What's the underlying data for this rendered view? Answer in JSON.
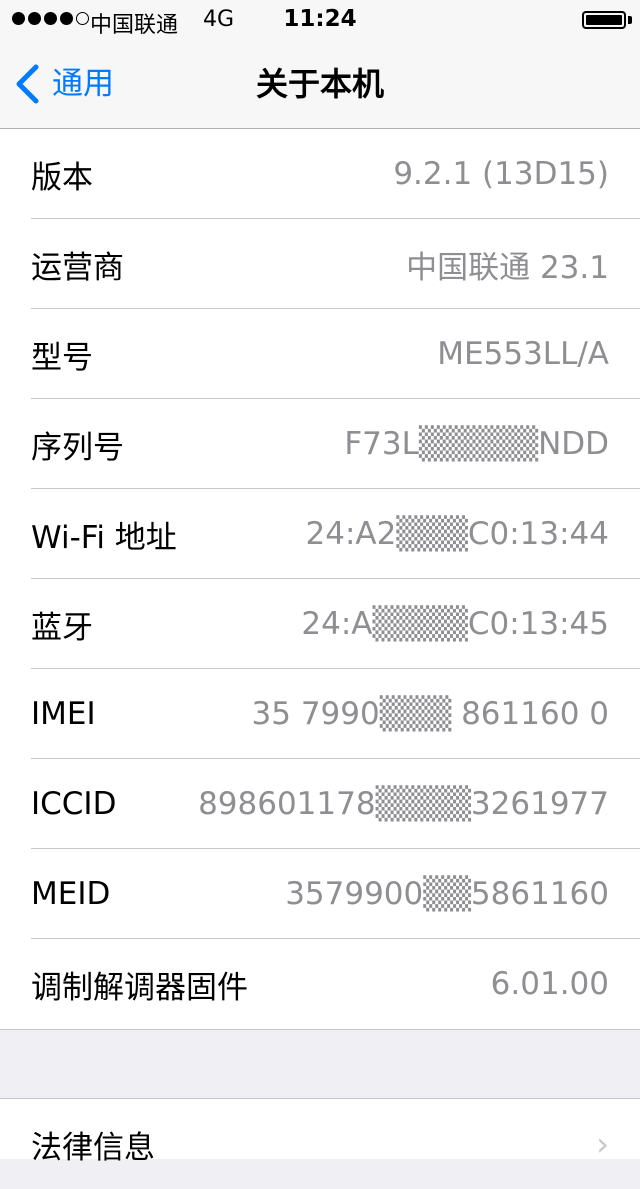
{
  "status_bar": {
    "carrier": "中国联通",
    "network": "4G",
    "time": "11:24"
  },
  "nav": {
    "back_label": "通用",
    "title": "关于本机"
  },
  "rows": [
    {
      "label": "版本",
      "value": "9.2.1 (13D15)"
    },
    {
      "label": "运营商",
      "value": "中国联通 23.1"
    },
    {
      "label": "型号",
      "value": "ME553LL/A"
    },
    {
      "label": "序列号",
      "value": "F73L▒▒▒▒▒NDD"
    },
    {
      "label": "Wi-Fi 地址",
      "value": "24:A2▒▒▒C0:13:44"
    },
    {
      "label": "蓝牙",
      "value": "24:A▒▒▒▒C0:13:45"
    },
    {
      "label": "IMEI",
      "value": "35 7990▒▒▒ 861160 0"
    },
    {
      "label": "ICCID",
      "value": "898601178▒▒▒▒3261977"
    },
    {
      "label": "MEID",
      "value": "3579900▒▒5861160"
    },
    {
      "label": "调制解调器固件",
      "value": "6.01.00"
    }
  ],
  "legal": {
    "label": "法律信息"
  },
  "colors": {
    "accent": "#007aff",
    "secondary_text": "#8e8e93",
    "background": "#efeff4"
  }
}
